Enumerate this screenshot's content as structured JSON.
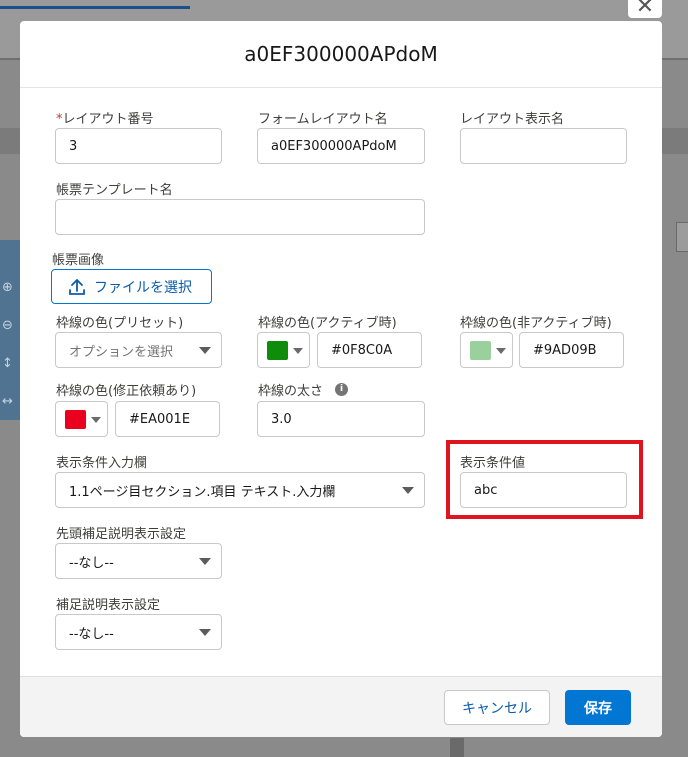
{
  "modal": {
    "title": "a0EF300000APdoM",
    "close_icon": "close-icon"
  },
  "form": {
    "layout_number": {
      "label": "レイアウト番号",
      "required_mark": "*",
      "value": "3"
    },
    "form_layout_name": {
      "label": "フォームレイアウト名",
      "value": "a0EF300000APdoM"
    },
    "layout_display_name": {
      "label": "レイアウト表示名",
      "value": ""
    },
    "template_name": {
      "label": "帳票テンプレート名",
      "value": ""
    },
    "form_image": {
      "label": "帳票画像",
      "button_label": "ファイルを選択",
      "icon": "upload-icon"
    },
    "border_preset": {
      "label": "枠線の色(プリセット)",
      "placeholder": "オプションを選択"
    },
    "border_active": {
      "label": "枠線の色(アクティブ時)",
      "color": "#0F8C0A",
      "value": "#0F8C0A"
    },
    "border_inactive": {
      "label": "枠線の色(非アクティブ時)",
      "color": "#9AD09B",
      "value": "#9AD09B"
    },
    "border_revision": {
      "label": "枠線の色(修正依頼あり)",
      "color": "#EA001E",
      "value": "#EA001E"
    },
    "border_thickness": {
      "label": "枠線の太さ",
      "value": "3.0",
      "icon": "info-icon"
    },
    "condition_input": {
      "label": "表示条件入力欄",
      "value": "1.1ページ目セクション.項目 テキスト.入力欄"
    },
    "condition_value": {
      "label": "表示条件値",
      "value": "abc"
    },
    "leading_note": {
      "label": "先頭補足説明表示設定",
      "value": "--なし--"
    },
    "note": {
      "label": "補足説明表示設定",
      "value": "--なし--"
    }
  },
  "footer": {
    "cancel_label": "キャンセル",
    "save_label": "保存"
  },
  "highlight_color": "#E0141E",
  "brand_color": "#0176D3"
}
